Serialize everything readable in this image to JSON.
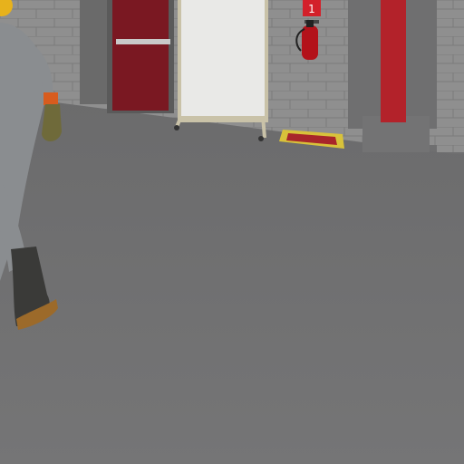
{
  "scene": {
    "colors": {
      "floor": "#727273",
      "wall": "#8f8f8f",
      "brick_line": "#7c7c7c",
      "door": "#7a1822",
      "door_frame": "#5a5a5a",
      "whiteboard": "#e9e9e7",
      "whiteboard_frame": "#c9c2a8",
      "extinguisher": "#b3121a",
      "sign": "#d3202a",
      "floor_mark_yellow": "#d8c23a",
      "floor_mark_red": "#a8262a",
      "pipe": "#b3222a",
      "pillar": "#6f6f70",
      "worker_suit": "#8a8d90",
      "worker_boot": "#3a3a38",
      "worker_glove": "#6f6a3a",
      "helmet": "#e7b21c",
      "cuff": "#d85c1e"
    },
    "sign_icon": "fire-extinguisher-sign-icon",
    "sign_glyph": "1"
  }
}
